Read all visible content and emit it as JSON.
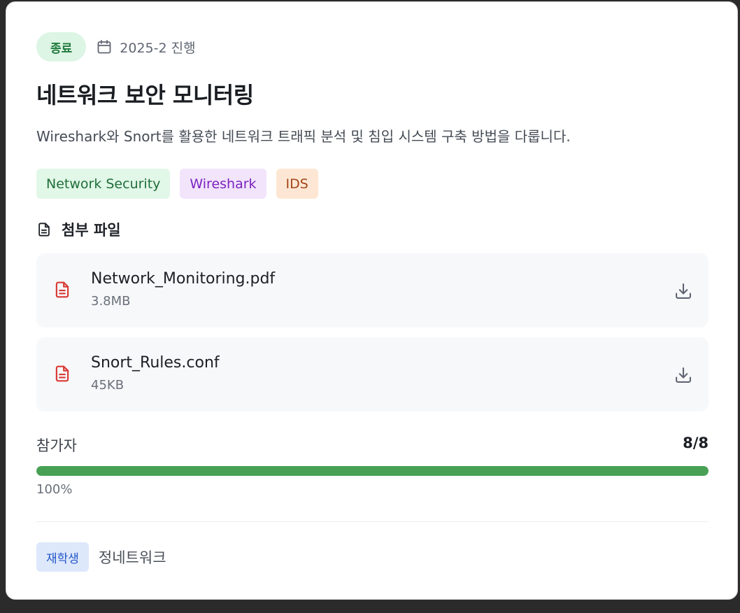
{
  "status": "종료",
  "semester": "2025-2 진행",
  "title": "네트워크 보안 모니터링",
  "description": "Wireshark와 Snort를 활용한 네트워크 트래픽 분석 및 침입 시스템 구축 방법을 다룹니다.",
  "tags": [
    "Network Security",
    "Wireshark",
    "IDS"
  ],
  "attachments": {
    "heading": "첨부 파일",
    "files": [
      {
        "name": "Network_Monitoring.pdf",
        "size": "3.8MB"
      },
      {
        "name": "Snort_Rules.conf",
        "size": "45KB"
      }
    ]
  },
  "participants": {
    "label": "참가자",
    "count": "8/8",
    "percent_text": "100%",
    "progress": 1.0
  },
  "footer": {
    "role": "재학생",
    "name": "정네트워크"
  },
  "colors": {
    "progress_fill": "#48a055",
    "file_icon": "#d93a34",
    "status_green": "#207a3e"
  },
  "icons": {
    "calendar": "calendar-icon",
    "document": "document-icon",
    "file": "file-icon",
    "download": "download-icon"
  }
}
